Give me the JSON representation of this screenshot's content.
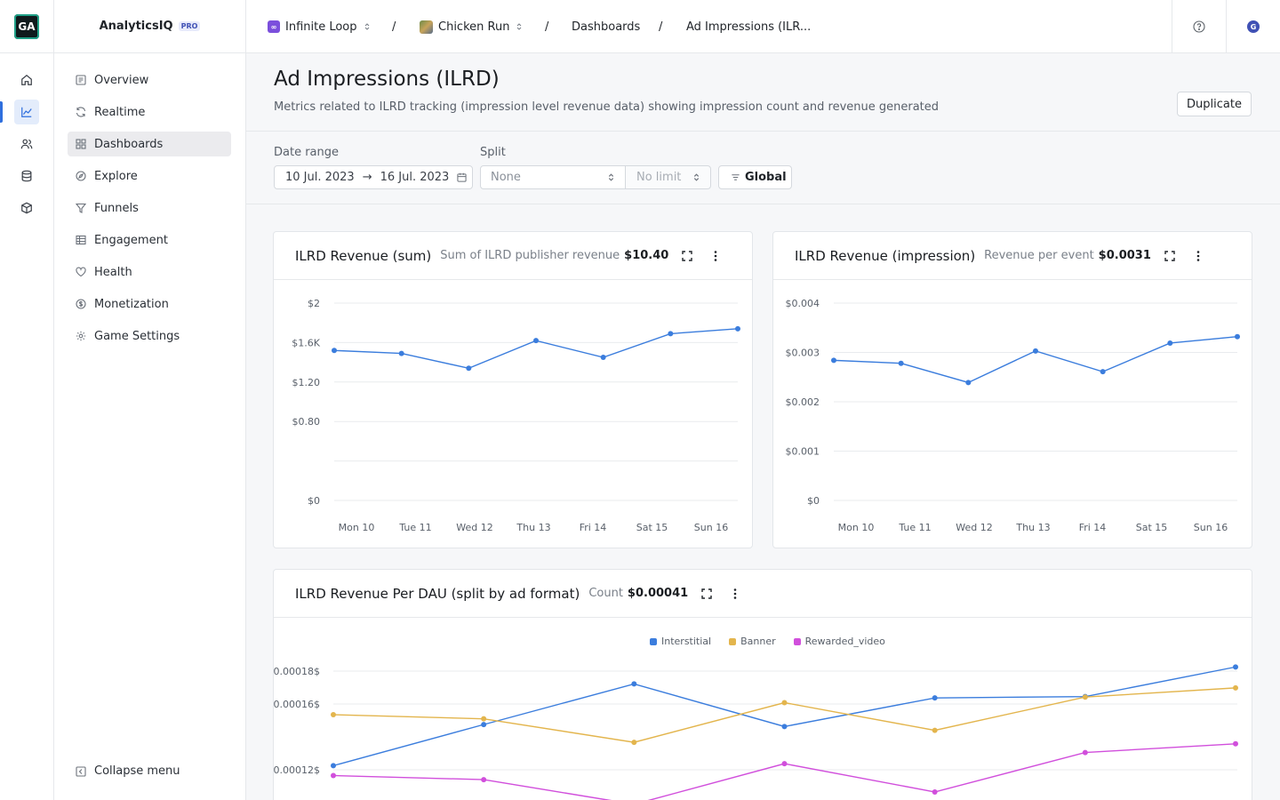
{
  "app": {
    "logo": "GA",
    "name": "AnalyticsIQ",
    "badge": "PRO"
  },
  "rail": {
    "icons": [
      "home-icon",
      "chart-icon",
      "users-icon",
      "database-icon",
      "package-icon"
    ],
    "active": 1
  },
  "sidebar": {
    "items": [
      {
        "label": "Overview",
        "icon": "overview-icon"
      },
      {
        "label": "Realtime",
        "icon": "refresh-icon"
      },
      {
        "label": "Dashboards",
        "icon": "grid-icon",
        "active": true
      },
      {
        "label": "Explore",
        "icon": "compass-icon"
      },
      {
        "label": "Funnels",
        "icon": "funnel-icon"
      },
      {
        "label": "Engagement",
        "icon": "table-icon"
      },
      {
        "label": "Health",
        "icon": "heart-icon"
      },
      {
        "label": "Monetization",
        "icon": "dollar-icon"
      },
      {
        "label": "Game Settings",
        "icon": "gear-icon"
      }
    ],
    "collapse_label": "Collapse menu"
  },
  "breadcrumb": {
    "org": "Infinite Loop",
    "org_icon": "∞",
    "game": "Chicken Run",
    "section": "Dashboards",
    "current": "Ad Impressions (ILR..."
  },
  "user": {
    "initial": "G"
  },
  "page": {
    "title": "Ad Impressions (ILRD)",
    "subtitle": "Metrics related to ILRD tracking (impression level revenue data) showing impression count and revenue generated",
    "duplicate_label": "Duplicate"
  },
  "filters": {
    "date_range_label": "Date range",
    "date_from": "10 Jul. 2023",
    "date_arrow": "→",
    "date_to": "16 Jul. 2023",
    "split_label": "Split",
    "split_value": "None",
    "limit_value": "No limit",
    "global_label": "Global"
  },
  "cards": [
    {
      "title": "ILRD Revenue (sum)",
      "metric_label": "Sum of ILRD publisher revenue",
      "metric_value": "$10.40"
    },
    {
      "title": "ILRD Revenue (impression)",
      "metric_label": "Revenue per event",
      "metric_value": "$0.0031"
    },
    {
      "title": "ILRD Revenue Per DAU (split by ad format)",
      "metric_label": "Count",
      "metric_value": "$0.00041"
    }
  ],
  "colors": {
    "accent": "#3b7ddd",
    "interstitial": "#3b7ddd",
    "banner": "#e3b54d",
    "rewarded": "#d14fdc"
  },
  "chart_data": [
    {
      "type": "line",
      "categories": [
        "Mon 10",
        "Tue 11",
        "Wed 12",
        "Thu 13",
        "Fri 14",
        "Sat 15",
        "Sun 16"
      ],
      "series": [
        {
          "values": [
            1.52,
            1.49,
            1.34,
            1.62,
            1.45,
            1.69,
            1.74
          ]
        }
      ],
      "ylim": [
        0,
        2
      ],
      "yticks": [
        0,
        0.4,
        0.8,
        1.2,
        1.6,
        2
      ],
      "ytick_labels": [
        "$0",
        "",
        "$0.80",
        "$1.20",
        "$1.6K",
        "$2"
      ],
      "grid": true
    },
    {
      "type": "line",
      "categories": [
        "Mon 10",
        "Tue 11",
        "Wed 12",
        "Thu 13",
        "Fri 14",
        "Sat 15",
        "Sun 16"
      ],
      "series": [
        {
          "values": [
            0.00284,
            0.00278,
            0.00239,
            0.00303,
            0.00261,
            0.00319,
            0.00332
          ]
        }
      ],
      "ylim": [
        0,
        0.004
      ],
      "yticks": [
        0,
        0.001,
        0.002,
        0.003,
        0.004
      ],
      "ytick_labels": [
        "$0",
        "$0.001",
        "$0.002",
        "$0.003",
        "$0.004"
      ],
      "grid": true
    },
    {
      "type": "line",
      "series": [
        {
          "name": "Interstitial",
          "values": [
            0.0001225,
            0.0001475,
            0.0001722,
            0.0001463,
            0.0001637,
            0.0001645,
            0.0001825
          ]
        },
        {
          "name": "Banner",
          "values": [
            0.0001535,
            0.000151,
            0.0001367,
            0.0001608,
            0.000144,
            0.0001642,
            0.0001698
          ]
        },
        {
          "name": "Rewarded_video",
          "values": [
            0.0001165,
            0.000114,
            9.9e-05,
            0.0001237,
            0.0001065,
            0.0001305,
            0.0001358
          ]
        }
      ],
      "yticks": [
        0.00012,
        0.00016,
        0.00018
      ],
      "ytick_labels": [
        "0.00012$",
        "0.00016$",
        "0.00018$"
      ],
      "legend": "top-center",
      "grid": true
    }
  ]
}
